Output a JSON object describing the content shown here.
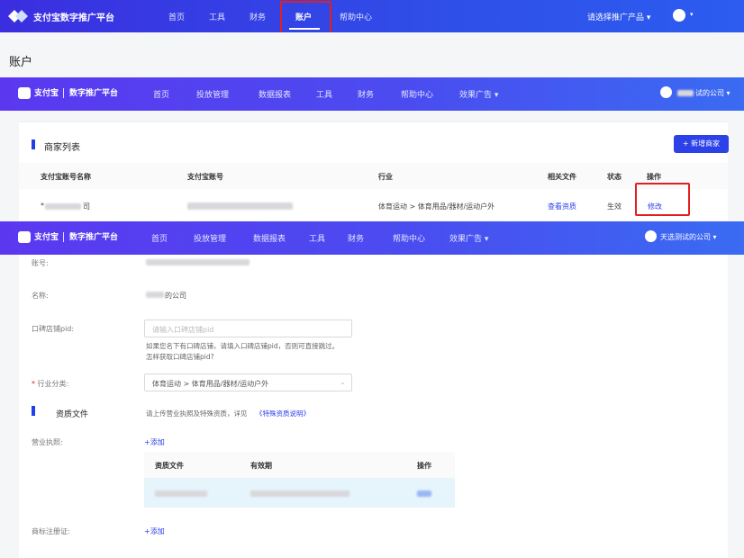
{
  "top_nav": {
    "brand": "支付宝数字推广平台",
    "items": [
      "首页",
      "工具",
      "财务",
      "账户",
      "帮助中心"
    ],
    "active": "账户",
    "product_select": "请选择推广产品 ▾"
  },
  "page": {
    "title": "账户"
  },
  "platform_nav": {
    "logo_text": "支付宝",
    "platform_name": "数字推广平台",
    "items": [
      "首页",
      "投放管理",
      "数据报表",
      "工具",
      "财务",
      "帮助中心",
      "效果广告 ▾"
    ],
    "user_name_full": "天选测试的公司 ▾",
    "user_name_partial": "试的公司 ▾"
  },
  "merchant_list": {
    "title": "商家列表",
    "add_button": "+ 新增商家",
    "columns": [
      "支付宝账号名称",
      "支付宝账号",
      "行业",
      "相关文件",
      "状态",
      "操作"
    ],
    "rows": [
      {
        "name_prefix": "*",
        "name_suffix": "司",
        "industry": "体育运动 > 体育用品/器材/运动户外",
        "files": "查看资质",
        "status": "生效",
        "action": "修改"
      }
    ]
  },
  "form": {
    "account_label": "账号:",
    "name_label": "名称:",
    "name_value_suffix": "的公司",
    "koubei_label": "口碑店铺pid:",
    "koubei_placeholder": "请输入口碑店铺pid",
    "koubei_hint": "如果您名下有口碑店铺，请填入口碑店铺pid，否则可直接跳过。",
    "koubei_link": "怎样获取口碑店铺pid?",
    "industry_label": "行业分类:",
    "industry_value": "体育运动 > 体育用品/器材/运动户外",
    "qual_title": "资质文件",
    "qual_desc_prefix": "请上传营业执照及特殊资质，详见",
    "qual_desc_link": "《特殊资质说明》",
    "license_label": "营业执照:",
    "add_link": "+添加",
    "table_columns": [
      "资质文件",
      "有效期",
      "操作"
    ],
    "trademark_label": "商标注册证:",
    "trademark_add": "+添加"
  },
  "colors": {
    "primary": "#2c41e8",
    "highlight_box": "#e02020"
  }
}
